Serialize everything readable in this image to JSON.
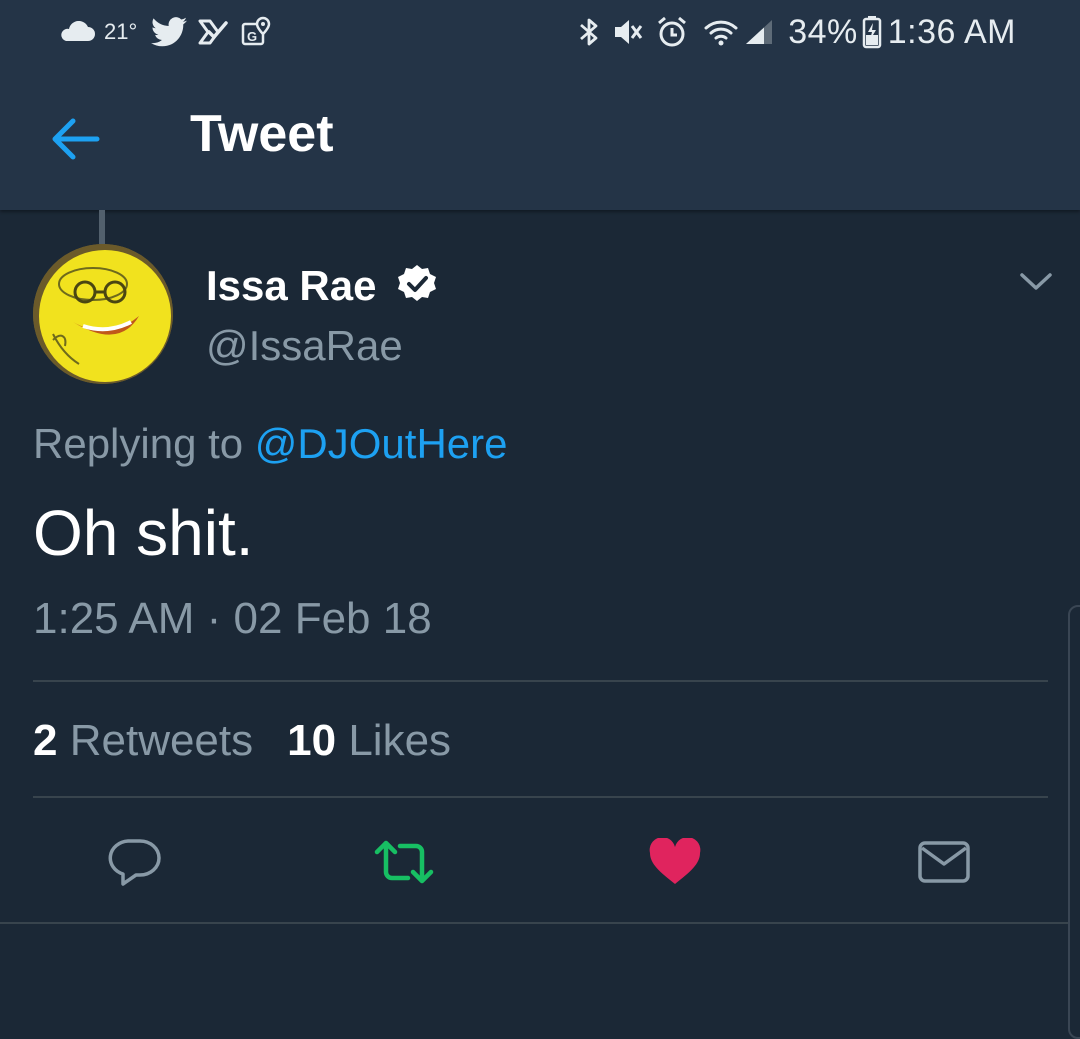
{
  "status_bar": {
    "temperature": "21°",
    "battery": "34%",
    "time": "1:36 AM",
    "left_icons": [
      "cloud-icon",
      "twitter-bird-icon",
      "tasks-check-icon",
      "maps-pin-icon"
    ],
    "right_icons": [
      "bluetooth-icon",
      "mute-icon",
      "alarm-icon",
      "wifi-icon",
      "signal-icon",
      "battery-charging-icon"
    ]
  },
  "toolbar": {
    "title": "Tweet",
    "back_icon": "arrow-left-icon"
  },
  "tweet": {
    "author_name": "Issa Rae",
    "author_handle": "@IssaRae",
    "verified": true,
    "replying_to_label": "Replying to",
    "replying_to_handle": "@DJOutHere",
    "text": "Oh shit.",
    "timestamp": "1:25 AM · 02 Feb 18",
    "retweet_count": "2",
    "retweet_label": "Retweets",
    "like_count": "10",
    "like_label": "Likes"
  },
  "actions": [
    {
      "name": "reply",
      "icon": "reply-bubble-icon"
    },
    {
      "name": "retweet",
      "icon": "retweet-icon",
      "active": true
    },
    {
      "name": "like",
      "icon": "heart-icon",
      "active": true
    },
    {
      "name": "direct-message",
      "icon": "envelope-icon"
    }
  ],
  "colors": {
    "background": "#1b2836",
    "header": "#243447",
    "accent_blue": "#1da1f2",
    "retweet_green": "#17bf63",
    "like_red": "#e0245e",
    "muted_text": "#8899a6"
  }
}
